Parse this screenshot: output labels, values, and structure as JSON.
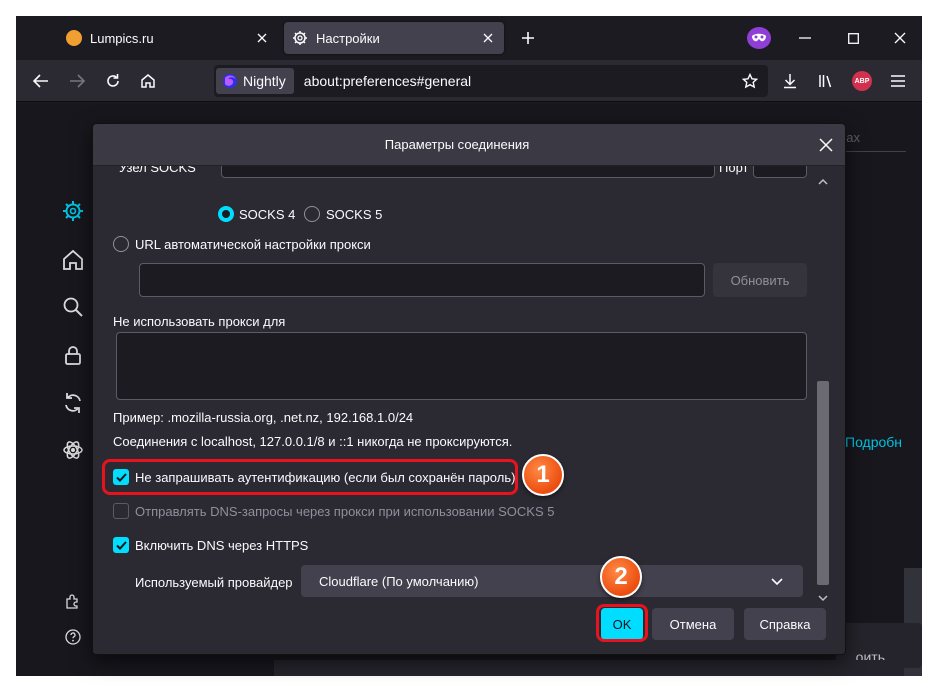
{
  "tabs": [
    {
      "label": "Lumpics.ru"
    },
    {
      "label": "Настройки"
    }
  ],
  "toolbar": {
    "identity_label": "Nightly",
    "url": "about:preferences#general",
    "abp_label": "ABP"
  },
  "background": {
    "search_hint": "ах",
    "link_more": "Подробн",
    "button_fragment": "...оить..."
  },
  "dialog": {
    "title": "Параметры соединения",
    "socks_host_label_partial": "Узел SOCKS",
    "port_label_partial": "Порт",
    "socks4_label": "SOCKS 4",
    "socks5_label": "SOCKS 5",
    "auto_proxy_label": "URL автоматической настройки прокси",
    "reload_label": "Обновить",
    "no_proxy_label": "Не использовать прокси для",
    "example_text": "Пример: .mozilla-russia.org, .net.nz, 192.168.1.0/24",
    "localhost_text": "Соединения с localhost, 127.0.0.1/8 и ::1 никогда не проксируются.",
    "no_auth_label": "Не запрашивать аутентификацию (если был сохранён пароль)",
    "socks_dns_label": "Отправлять DNS-запросы через прокси при использовании SOCKS 5",
    "doh_label": "Включить DNS через HTTPS",
    "provider_label": "Используемый провайдер",
    "provider_value": "Cloudflare (По умолчанию)",
    "ok_label": "OK",
    "cancel_label": "Отмена",
    "help_label": "Справка"
  },
  "annotations": {
    "badge_1": "1",
    "badge_2": "2"
  }
}
